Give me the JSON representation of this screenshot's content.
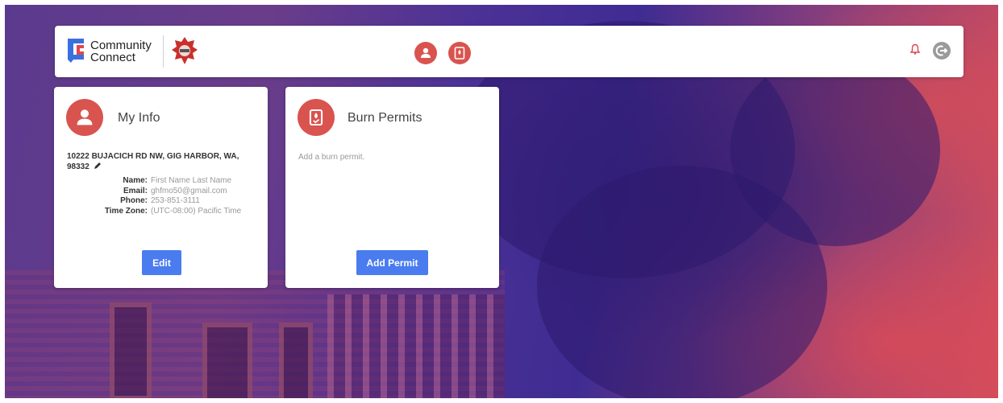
{
  "header": {
    "brand_line1": "Community",
    "brand_line2": "Connect",
    "nav_icons": [
      "user-icon",
      "burn-permit-icon"
    ],
    "right_icons": [
      "bell-icon",
      "logout-icon"
    ]
  },
  "my_info": {
    "title": "My Info",
    "address_line1": "10222 BUJACICH RD NW, GIG HARBOR, WA,",
    "address_line2": "98332",
    "fields": [
      {
        "label": "Name:",
        "value": "First Name Last Name"
      },
      {
        "label": "Email:",
        "value": "ghfmo50@gmail.com"
      },
      {
        "label": "Phone:",
        "value": "253-851-3111"
      },
      {
        "label": "Time Zone:",
        "value": "(UTC-08:00) Pacific Time"
      }
    ],
    "edit_label": "Edit"
  },
  "burn_permits": {
    "title": "Burn Permits",
    "subtext": "Add a burn permit.",
    "add_label": "Add Permit"
  },
  "colors": {
    "accent_red": "#d9534f",
    "button_blue": "#4a7cf0"
  }
}
